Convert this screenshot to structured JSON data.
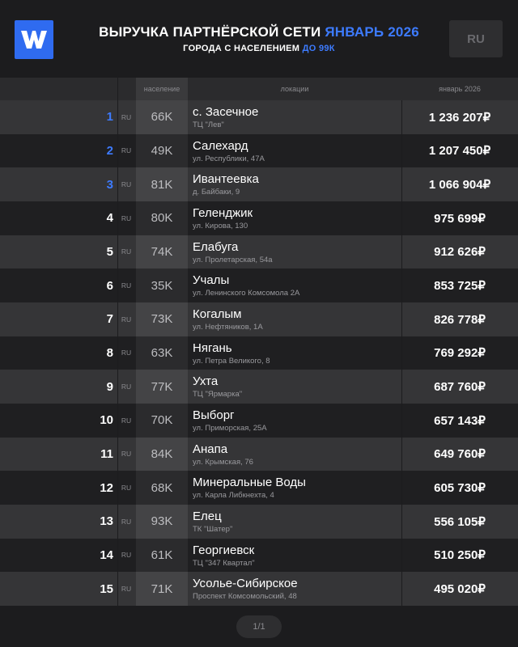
{
  "header": {
    "logo_letter": "W",
    "title_main": "ВЫРУЧКА ПАРТНЁРСКОЙ СЕТИ",
    "title_accent": "ЯНВАРЬ 2026",
    "subtitle_main": "ГОРОДА С НАСЕЛЕНИЕМ",
    "subtitle_accent": "ДО 99К",
    "country_button": "RU"
  },
  "table": {
    "headers": {
      "population": "население",
      "locations": "локации",
      "january": "январь 2026"
    },
    "rows": [
      {
        "rank": "1",
        "country": "RU",
        "population": "66K",
        "city": "с. Засечное",
        "address": "ТЦ \"Лев\"",
        "revenue": "1 236 207₽"
      },
      {
        "rank": "2",
        "country": "RU",
        "population": "49K",
        "city": "Салехард",
        "address": "ул. Республики, 47А",
        "revenue": "1 207 450₽"
      },
      {
        "rank": "3",
        "country": "RU",
        "population": "81K",
        "city": "Ивантеевка",
        "address": "д. Байбаки, 9",
        "revenue": "1 066 904₽"
      },
      {
        "rank": "4",
        "country": "RU",
        "population": "80K",
        "city": "Геленджик",
        "address": "ул. Кирова, 130",
        "revenue": "975 699₽"
      },
      {
        "rank": "5",
        "country": "RU",
        "population": "74K",
        "city": "Елабуга",
        "address": "ул. Пролетарская, 54а",
        "revenue": "912 626₽"
      },
      {
        "rank": "6",
        "country": "RU",
        "population": "35K",
        "city": "Учалы",
        "address": "ул. Ленинского Комсомола 2А",
        "revenue": "853 725₽"
      },
      {
        "rank": "7",
        "country": "RU",
        "population": "73K",
        "city": "Когалым",
        "address": "ул. Нефтяников, 1А",
        "revenue": "826 778₽"
      },
      {
        "rank": "8",
        "country": "RU",
        "population": "63K",
        "city": "Нягань",
        "address": "ул. Петра Великого, 8",
        "revenue": "769 292₽"
      },
      {
        "rank": "9",
        "country": "RU",
        "population": "77K",
        "city": "Ухта",
        "address": "ТЦ \"Ярмарка\"",
        "revenue": "687 760₽"
      },
      {
        "rank": "10",
        "country": "RU",
        "population": "70K",
        "city": "Выборг",
        "address": "ул. Приморская, 25А",
        "revenue": "657 143₽"
      },
      {
        "rank": "11",
        "country": "RU",
        "population": "84K",
        "city": "Анапа",
        "address": "ул. Крымская, 76",
        "revenue": "649 760₽"
      },
      {
        "rank": "12",
        "country": "RU",
        "population": "68K",
        "city": "Минеральные Воды",
        "address": "ул. Карла Либкнехта, 4",
        "revenue": "605 730₽"
      },
      {
        "rank": "13",
        "country": "RU",
        "population": "93K",
        "city": "Елец",
        "address": "ТК \"Шатер\"",
        "revenue": "556 105₽"
      },
      {
        "rank": "14",
        "country": "RU",
        "population": "61K",
        "city": "Георгиевск",
        "address": "ТЦ \"347 Квартал\"",
        "revenue": "510 250₽"
      },
      {
        "rank": "15",
        "country": "RU",
        "population": "71K",
        "city": "Усолье-Сибирское",
        "address": "Проспект Комсомольский, 48",
        "revenue": "495 020₽"
      }
    ]
  },
  "pager": {
    "label": "1/1"
  },
  "colors": {
    "accent": "#3d7bff",
    "logo": "#2f6bf0",
    "background": "#1c1c1e"
  },
  "icons": {
    "logo": "brand-w-logo-icon"
  }
}
